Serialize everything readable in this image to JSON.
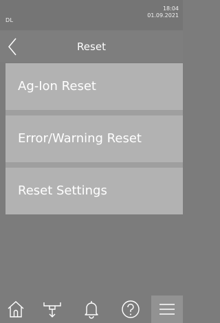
{
  "status_bar": {
    "device_label": "DL",
    "time": "18:04",
    "date": "01.09.2021"
  },
  "header": {
    "title": "Reset",
    "back_icon": "chevron-left-icon"
  },
  "menu": {
    "items": [
      {
        "label": "Ag-Ion Reset"
      },
      {
        "label": "Error/Warning Reset"
      },
      {
        "label": "Reset Settings"
      }
    ]
  },
  "footer": {
    "nav": [
      {
        "icon": "home-icon"
      },
      {
        "icon": "drain-icon"
      },
      {
        "icon": "bell-icon"
      },
      {
        "icon": "help-icon"
      },
      {
        "icon": "menu-icon",
        "active": true
      }
    ]
  },
  "colors": {
    "background": "#7c7c7c",
    "menu_item": "#b2b2b2",
    "divider": "#9f9f9f",
    "text": "#ffffff"
  }
}
